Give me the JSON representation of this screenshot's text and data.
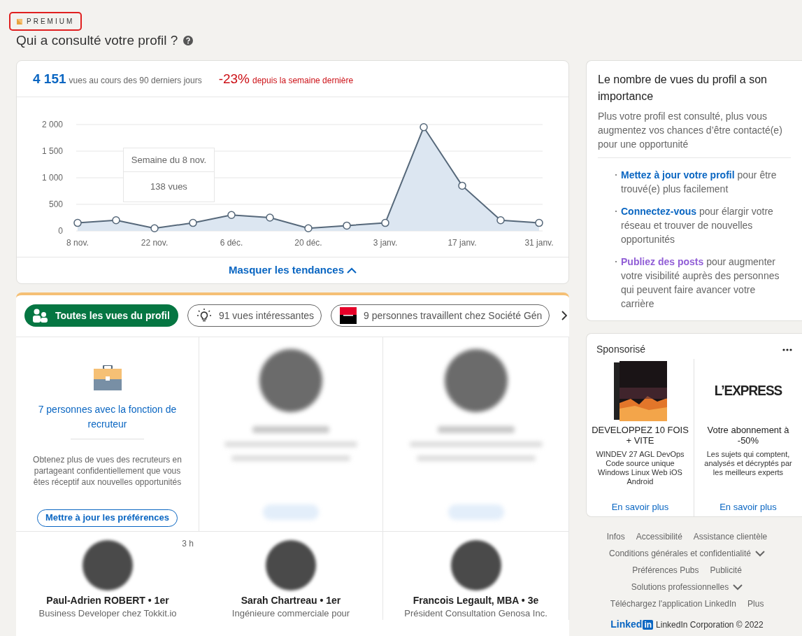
{
  "badge": {
    "label": "PREMIUM",
    "highlighted": true
  },
  "page_title": "Qui a consulté votre profil ?",
  "summary": {
    "total": "4 151",
    "total_caption": "vues au cours des 90 derniers jours",
    "change": "-23%",
    "change_caption": "depuis la semaine dernière"
  },
  "chart": {
    "chart_data": {
      "type": "area",
      "categories": [
        "8 nov.",
        null,
        "22 nov.",
        null,
        "6 déc.",
        null,
        "20 déc.",
        null,
        "3 janv.",
        null,
        "17 janv.",
        null,
        "31 janv."
      ],
      "series": [
        {
          "color": "#56687a",
          "values": [
            150,
            200,
            50,
            150,
            300,
            250,
            50,
            100,
            150,
            1950,
            850,
            200,
            150
          ]
        }
      ],
      "ylim": [
        0,
        2000
      ],
      "grid": true,
      "yticks": [
        {
          "value": 0,
          "label": "0"
        },
        {
          "value": 500,
          "label": "500"
        },
        {
          "value": 1000,
          "label": "1 000"
        },
        {
          "value": 1500,
          "label": "1 500"
        },
        {
          "value": 2000,
          "label": "2 000"
        }
      ]
    },
    "tooltip": {
      "title": "Semaine du 8 nov.",
      "value": "138 vues"
    }
  },
  "toggle_link": {
    "label": "Masquer les tendances",
    "expanded": true
  },
  "filters": [
    {
      "kind": "people",
      "label": "Toutes les vues du profil",
      "selected": true
    },
    {
      "kind": "insight",
      "label": "91 vues intéressantes",
      "selected": false
    },
    {
      "kind": "company",
      "label": "9 personnes travaillent chez Société Gén",
      "selected": false
    }
  ],
  "recruiter_cell": {
    "link": "7 personnes avec la fonction de recruteur",
    "description": "Obtenez plus de vues des recruteurs en partageant confidentiellement que vous êtes réceptif aux nouvelles opportunités",
    "button": "Mettre à jour les préférences"
  },
  "viewers": [
    {
      "blurred": true
    },
    {
      "blurred": true
    },
    {
      "blurred": false,
      "time": "3 h",
      "name": "Paul-Adrien ROBERT • 1er",
      "headline": "Business Developer chez Tokkit.io"
    },
    {
      "blurred": false,
      "name": "Sarah Chartreau • 1er",
      "headline": "Ingénieure commerciale pour"
    },
    {
      "blurred": false,
      "name": "Francois Legault, MBA • 3e",
      "headline": "Président Consultation Genosa Inc."
    }
  ],
  "info_card": {
    "title": "Le nombre de vues du profil a son importance",
    "description": "Plus votre profil est consulté, plus vous augmentez vos chances d’être contacté(e) pour une opportunité",
    "tips": [
      {
        "link": "Mettez à jour votre profil",
        "text": "pour être trouvé(e) plus facilement",
        "visited": false
      },
      {
        "link": "Connectez-vous",
        "text": "pour élargir votre réseau et trouver de nouvelles opportunités",
        "visited": false
      },
      {
        "link": "Publiez des posts",
        "text": "pour augmenter votre visibilité auprès des personnes qui peuvent faire avancer votre carrière",
        "visited": true
      }
    ]
  },
  "sponsored": {
    "label": "Sponsorisé",
    "ads": [
      {
        "kind": "product-box",
        "headline": "DEVELOPPEZ 10 FOIS + VITE",
        "description": "WINDEV 27 AGL DevOps Code source unique Windows Linux Web iOS Android",
        "cta": "En savoir plus"
      },
      {
        "kind": "logo",
        "logo_text": "L’EXPRESS",
        "headline": "Votre abonnement à -50%",
        "description": "Les sujets qui comptent, analysés et décryptés par les meilleurs experts",
        "cta": "En savoir plus"
      }
    ]
  },
  "footer": {
    "links": [
      {
        "label": "Infos",
        "has_menu": false
      },
      {
        "label": "Accessibilité",
        "has_menu": false
      },
      {
        "label": "Assistance clientèle",
        "has_menu": false
      },
      {
        "label": "Conditions générales et confidentialité",
        "has_menu": true
      },
      {
        "label": "Préférences Pubs",
        "has_menu": false
      },
      {
        "label": "Publicité",
        "has_menu": false
      },
      {
        "label": "Solutions professionnelles",
        "has_menu": true
      },
      {
        "label": "Téléchargez l'application LinkedIn",
        "has_menu": false
      },
      {
        "label": "Plus",
        "has_menu": false
      }
    ],
    "logo_word": "Linked",
    "logo_box": "in",
    "copyright": "LinkedIn Corporation © 2022"
  }
}
